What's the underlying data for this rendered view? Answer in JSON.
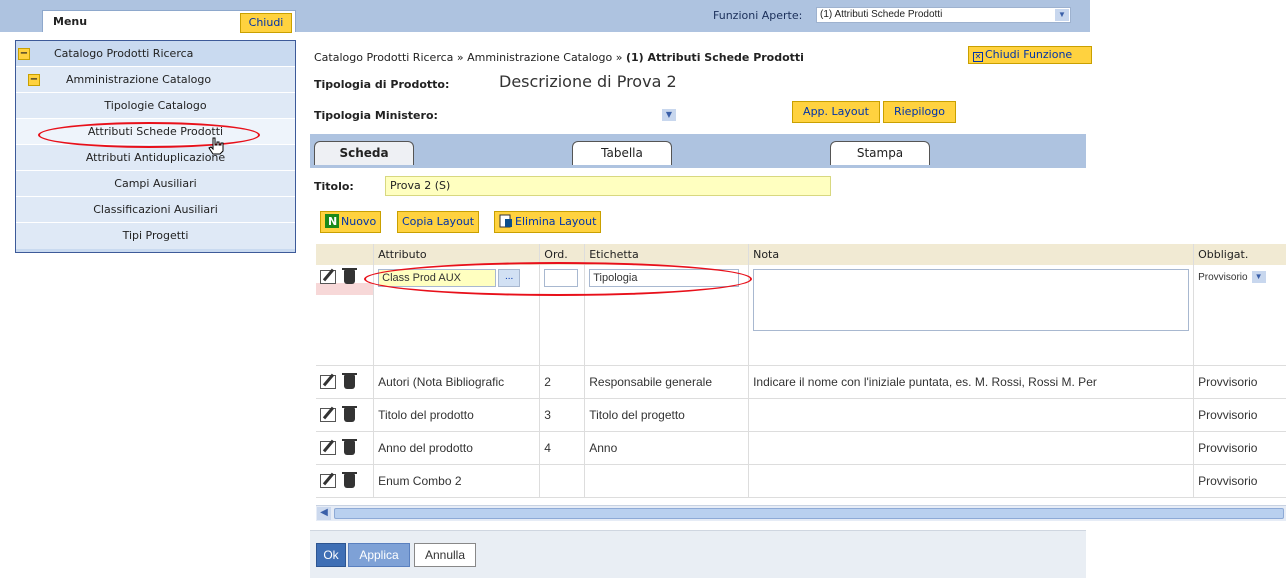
{
  "topbar": {
    "menu_label": "Menu",
    "chiudi_label": "Chiudi",
    "funzioni_label": "Funzioni Aperte:",
    "funzioni_value": "(1) Attributi Schede Prodotti"
  },
  "sidebar": {
    "items": [
      {
        "label": "Catalogo Prodotti Ricerca",
        "expander": "−"
      },
      {
        "label": "Amministrazione Catalogo",
        "expander": "−"
      },
      {
        "label": "Tipologie Catalogo"
      },
      {
        "label": "Attributi Schede Prodotti"
      },
      {
        "label": "Attributi Antiduplicazione"
      },
      {
        "label": "Campi Ausiliari"
      },
      {
        "label": "Classificazioni Ausiliari"
      },
      {
        "label": "Tipi Progetti"
      }
    ]
  },
  "breadcrumb": {
    "path": "Catalogo Prodotti Ricerca » Amministrazione Catalogo » ",
    "current": "(1) Attributi Schede Prodotti"
  },
  "chiudi_funzione_label": "Chiudi Funzione",
  "form": {
    "tipologia_prodotto_label": "Tipologia di Prodotto:",
    "tipologia_prodotto_value": "Descrizione di Prova 2",
    "tipologia_ministero_label": "Tipologia Ministero:",
    "tipologia_ministero_value": "",
    "app_layout_label": "App. Layout",
    "riepilogo_label": "Riepilogo",
    "titolo_label": "Titolo:",
    "titolo_value": "Prova 2 (S)"
  },
  "tabs": [
    {
      "label": "Scheda",
      "active": true
    },
    {
      "label": "Tabella",
      "active": false
    },
    {
      "label": "Stampa",
      "active": false
    }
  ],
  "toolbar": {
    "nuovo_label": "Nuovo",
    "copia_label": "Copia Layout",
    "elimina_label": "Elimina Layout"
  },
  "grid": {
    "headers": [
      "",
      "Attributo",
      "Ord.",
      "Etichetta",
      "Nota",
      "Obbligat."
    ],
    "edit_row": {
      "attributo": "Class Prod AUX",
      "ordine": "",
      "etichetta": "Tipologia",
      "nota": "",
      "obbligatorio": "Provvisorio"
    },
    "rows": [
      {
        "attributo": "Autori (Nota Bibliografic",
        "ordine": "2",
        "etichetta": "Responsabile generale",
        "nota": "Indicare il nome con l'iniziale puntata, es. M. Rossi, Rossi M. Per",
        "obbligatorio": "Provvisorio"
      },
      {
        "attributo": "Titolo del prodotto",
        "ordine": "3",
        "etichetta": "Titolo del progetto",
        "nota": "",
        "obbligatorio": "Provvisorio"
      },
      {
        "attributo": "Anno del prodotto",
        "ordine": "4",
        "etichetta": "Anno",
        "nota": "",
        "obbligatorio": "Provvisorio"
      },
      {
        "attributo": "Enum Combo 2",
        "ordine": "",
        "etichetta": "",
        "nota": "",
        "obbligatorio": "Provvisorio"
      }
    ]
  },
  "footer": {
    "ok_label": "Ok",
    "applica_label": "Applica",
    "annulla_label": "Annulla"
  },
  "colors": {
    "accent_yellow": "#ffd23f",
    "header_blue": "#aec3e0",
    "annotation_red": "#e8101a"
  }
}
